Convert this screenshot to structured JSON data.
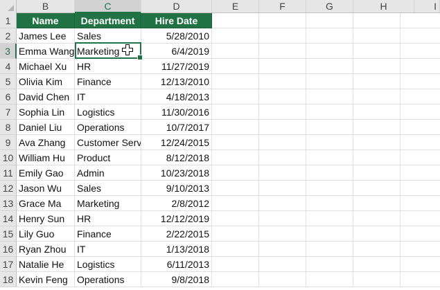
{
  "columns": [
    "B",
    "C",
    "D",
    "E",
    "F",
    "G",
    "H",
    "I"
  ],
  "selected_column": "C",
  "rows": [
    "1",
    "2",
    "3",
    "4",
    "5",
    "6",
    "7",
    "8",
    "9",
    "10",
    "11",
    "12",
    "13",
    "14",
    "15",
    "16",
    "17",
    "18"
  ],
  "selected_row": "3",
  "table": {
    "headers": [
      "Name",
      "Department",
      "Hire Date"
    ],
    "records": [
      [
        "James Lee",
        "Sales",
        "5/28/2010"
      ],
      [
        "Emma Wang",
        "Marketing",
        "6/4/2019"
      ],
      [
        "Michael Xu",
        "HR",
        "11/27/2019"
      ],
      [
        "Olivia Kim",
        "Finance",
        "12/13/2010"
      ],
      [
        "David Chen",
        "IT",
        "4/18/2013"
      ],
      [
        "Sophia Lin",
        "Logistics",
        "11/30/2016"
      ],
      [
        "Daniel Liu",
        "Operations",
        "10/7/2017"
      ],
      [
        "Ava Zhang",
        "Customer Serv",
        "12/24/2015"
      ],
      [
        "William Hu",
        "Product",
        "8/12/2018"
      ],
      [
        "Emily Gao",
        "Admin",
        "10/23/2018"
      ],
      [
        "Jason Wu",
        "Sales",
        "9/10/2013"
      ],
      [
        "Grace Ma",
        "Marketing",
        "2/8/2012"
      ],
      [
        "Henry Sun",
        "HR",
        "12/12/2019"
      ],
      [
        "Lily Guo",
        "Finance",
        "2/22/2015"
      ],
      [
        "Ryan Zhou",
        "IT",
        "1/13/2018"
      ],
      [
        "Natalie He",
        "Logistics",
        "6/11/2013"
      ],
      [
        "Kevin Feng",
        "Operations",
        "9/8/2018"
      ]
    ]
  },
  "active_cell": "C3",
  "colors": {
    "header_green": "#217346",
    "header_text": "#ffffff",
    "selection": "#217346"
  },
  "icons": {
    "cursor": "white-cross-cursor-icon",
    "corner": "select-all-triangle-icon"
  }
}
